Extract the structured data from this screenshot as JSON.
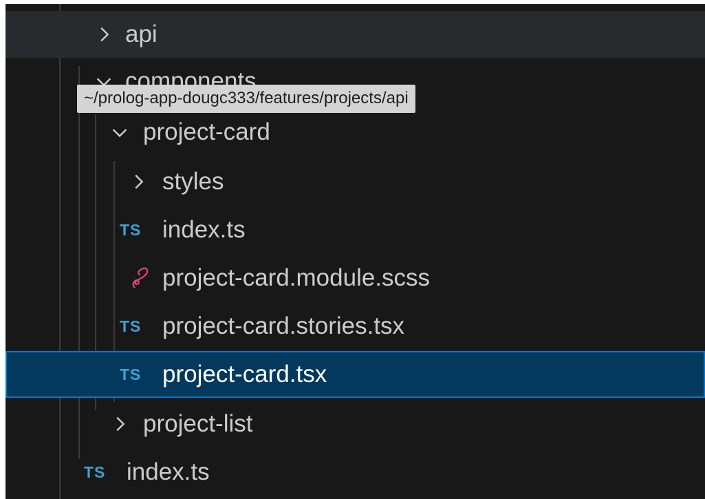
{
  "explorer": {
    "tooltip": "~/prolog-app-dougc333/features/projects/api",
    "items": [
      {
        "label": "api",
        "kind": "folder",
        "state": "collapsed"
      },
      {
        "label": "components",
        "kind": "folder",
        "state": "expanded"
      },
      {
        "label": "project-card",
        "kind": "folder",
        "state": "expanded"
      },
      {
        "label": "styles",
        "kind": "folder",
        "state": "collapsed"
      },
      {
        "label": "index.ts",
        "kind": "file",
        "icon": "TS"
      },
      {
        "label": "project-card.module.scss",
        "kind": "file",
        "icon": "sass-icon"
      },
      {
        "label": "project-card.stories.tsx",
        "kind": "file",
        "icon": "TS"
      },
      {
        "label": "project-card.tsx",
        "kind": "file",
        "icon": "TS",
        "selected": true
      },
      {
        "label": "project-list",
        "kind": "folder",
        "state": "collapsed"
      },
      {
        "label": "index.ts",
        "kind": "file",
        "icon": "TS"
      }
    ]
  },
  "colors": {
    "background": "#181818",
    "hover": "#282b2e",
    "selection": "#04395e",
    "selection_border": "#0078d4",
    "ts_icon": "#3fa0d4",
    "sass_icon": "#e0467f"
  }
}
